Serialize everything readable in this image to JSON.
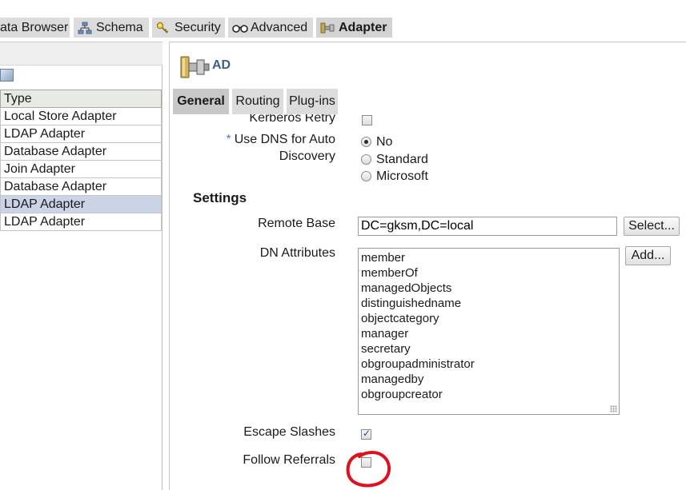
{
  "top_tabs": [
    {
      "label": "ata Browser",
      "icon": "data-browser-icon"
    },
    {
      "label": "Schema",
      "icon": "schema-icon"
    },
    {
      "label": "Security",
      "icon": "security-icon"
    },
    {
      "label": "Advanced",
      "icon": "advanced-icon"
    },
    {
      "label": "Adapter",
      "icon": "adapter-icon",
      "active": true
    }
  ],
  "left_panel": {
    "column_header": "Type",
    "rows": [
      "Local Store Adapter",
      "LDAP Adapter",
      "Database Adapter",
      "Join Adapter",
      "Database Adapter",
      "LDAP Adapter",
      "LDAP Adapter"
    ],
    "selected_row": 5
  },
  "adapter": {
    "title": "AD",
    "sub_tabs": [
      "General",
      "Routing",
      "Plug-ins"
    ],
    "active_sub_tab": "General"
  },
  "form": {
    "kerberos_retry_label": "Kerberos Retry",
    "kerberos_retry_checked": false,
    "use_dns_label_line1": "Use DNS for Auto",
    "use_dns_label_line2": "Discovery",
    "required_marker": "*",
    "dns_options": [
      "No",
      "Standard",
      "Microsoft"
    ],
    "dns_selected": "No",
    "settings_heading": "Settings",
    "remote_base_label": "Remote Base",
    "remote_base_value": "DC=gksm,DC=local",
    "select_button": "Select...",
    "dn_attributes_label": "DN Attributes",
    "dn_attributes": [
      "member",
      "memberOf",
      "managedObjects",
      "distinguishedname",
      "objectcategory",
      "manager",
      "secretary",
      "obgroupadministrator",
      "managedby",
      "obgroupcreator"
    ],
    "add_button": "Add...",
    "escape_slashes_label": "Escape Slashes",
    "escape_slashes_checked": true,
    "follow_referrals_label": "Follow Referrals",
    "follow_referrals_checked": false
  },
  "colors": {
    "tab_bg": "#dcdcdc",
    "selected_row": "#cbd3e6",
    "title_blue": "#3a5f8f",
    "annotation_red": "#e0101e"
  }
}
